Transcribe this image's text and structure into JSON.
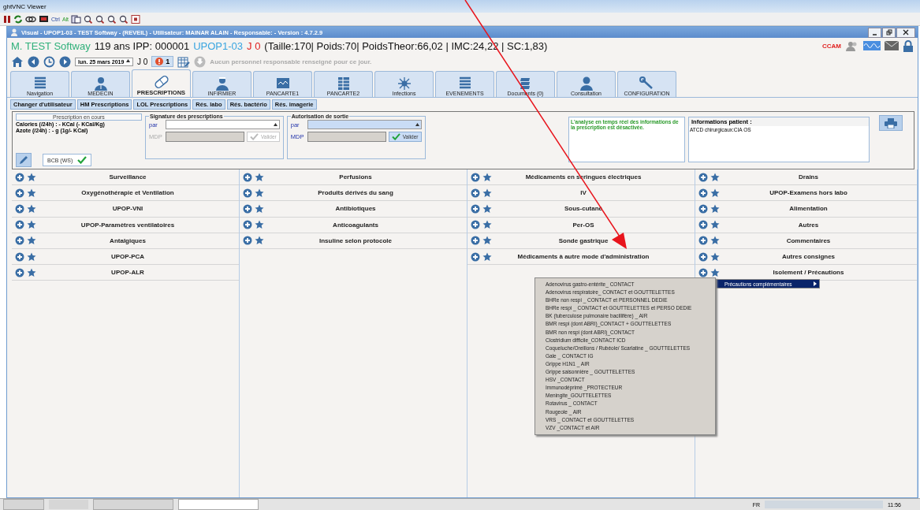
{
  "viewer": {
    "title": "ghtVNC Viewer",
    "keys": [
      "Ctrl",
      "Alt"
    ]
  },
  "window": {
    "title": "Visual - UPOP1-03 - TEST Softway - (REVEIL) - Utilisateur: MAINAR ALAIN - Responsable:  - Version : 4.7.2.9"
  },
  "patient": {
    "name": "M.  TEST Softway",
    "age_ipp": "119 ans IPP: 000001",
    "unit": "UPOP1-03",
    "day": "J 0",
    "measures": "(Taille:170| Poids:70| PoidsTheor:66,02 | IMC:24,22 | SC:1,83)",
    "ccam": "CCAM"
  },
  "nav": {
    "date": "lun. 25 mars 2019",
    "day": "J 0",
    "alerts": "1",
    "notice": "Aucun personnel responsable renseigné pour ce jour."
  },
  "tabs": [
    {
      "label": "Navigation",
      "selected": false
    },
    {
      "label": "MEDECIN",
      "selected": false
    },
    {
      "label": "PRESCRIPTIONS",
      "selected": true
    },
    {
      "label": "INFIRMIER",
      "selected": false
    },
    {
      "label": "PANCARTE1",
      "selected": false
    },
    {
      "label": "PANCARTE2",
      "selected": false
    },
    {
      "label": "Infections",
      "selected": false
    },
    {
      "label": "EVENEMENTS",
      "selected": false
    },
    {
      "label": "Documents (0)",
      "selected": false
    },
    {
      "label": "Consultation",
      "selected": false
    },
    {
      "label": "CONFIGURATION",
      "selected": false
    }
  ],
  "subtabs": [
    "Changer d'utilisateur",
    "HM Prescriptions",
    "LOL Prescriptions",
    "Rés. labo",
    "Rés. bactério",
    "Rés. imagerie"
  ],
  "prescription": {
    "heading": "Prescription en cours",
    "lines": [
      "Calories (/24h) : - KCal (- KCal/Kg)",
      "Azote (/24h) : - g (1g/- KCal)"
    ],
    "bcb": "BCB (WS)"
  },
  "signatures": [
    {
      "legend": "Signature des prescriptions",
      "par": "par",
      "mdp": "MDP",
      "button": "Valider",
      "disabled": true
    },
    {
      "legend": "Autorisation de sortie",
      "par": "par",
      "mdp": "MDP",
      "button": "Valider",
      "disabled": false
    }
  ],
  "analysis": "L'analyse en temps réel des informations de la prescription est désactivée.",
  "patient_info": {
    "heading": "Informations patient :",
    "text": "ATCD chirurgicaux:CIA OS"
  },
  "columns": [
    [
      "Surveillance",
      "Oxygénothérapie et Ventilation",
      "UPOP-VNI",
      "UPOP-Paramètres ventilatoires",
      "Antalgiques",
      "UPOP-PCA",
      "UPOP-ALR"
    ],
    [
      "Perfusions",
      "Produits dérivés du sang",
      "Antibiotiques",
      "Anticoagulants",
      "Insuline selon protocole"
    ],
    [
      "Médicaments en seringues électriques",
      "IV",
      "Sous-cutané",
      "Per-OS",
      "Sonde gastrique",
      "Médicaments à autre mode d'administration"
    ],
    [
      "Drains",
      "UPOP-Examens hors labo",
      "Alimentation",
      "Autres",
      "Commentaires",
      "Autres consignes",
      "Isolement / Précautions"
    ]
  ],
  "submenu": {
    "label": "Précautions complémentaires",
    "selected": true
  },
  "menu_items": [
    "Adenovirus gastro-entérite_ CONTACT",
    "Adenovirus respiratoire_ CONTACT et GOUTTELETTES",
    "BHRe non respi _ CONTACT et  PERSONNEL DEDIE",
    "BHRe respi _ CONTACT et GOUTTELETTES et PERSO DEDIE",
    "BK (tuberculose pulmonaire bacillifère) _ AIR",
    "BMR  respi (dont ABRI)_CONTACT + GOUTTELETTES",
    "BMR non respi (dont ABRI)_CONTACT",
    "Clostridium difficile_CONTACT ICD",
    "Coqueluche/Oreillons / Rubéole/ Scarlatine _ GOUTTELETTES",
    "Gale _ CONTACT IG",
    "Grippe H1N1 _  AIR",
    "Grippe saisonnière _ GOUTTELETTES",
    "HSV _CONTACT",
    "Immunodéprimé _PROTECTEUR",
    "Meningite_GOUTTELETTES",
    "Rotavirus _ CONTACT",
    "Rougeole _  AIR",
    "VRS _ CONTACT et  GOUTTELETTES",
    "VZV _CONTACT et AIR"
  ],
  "taskbar": {
    "language": "FR",
    "time": "11:56"
  }
}
